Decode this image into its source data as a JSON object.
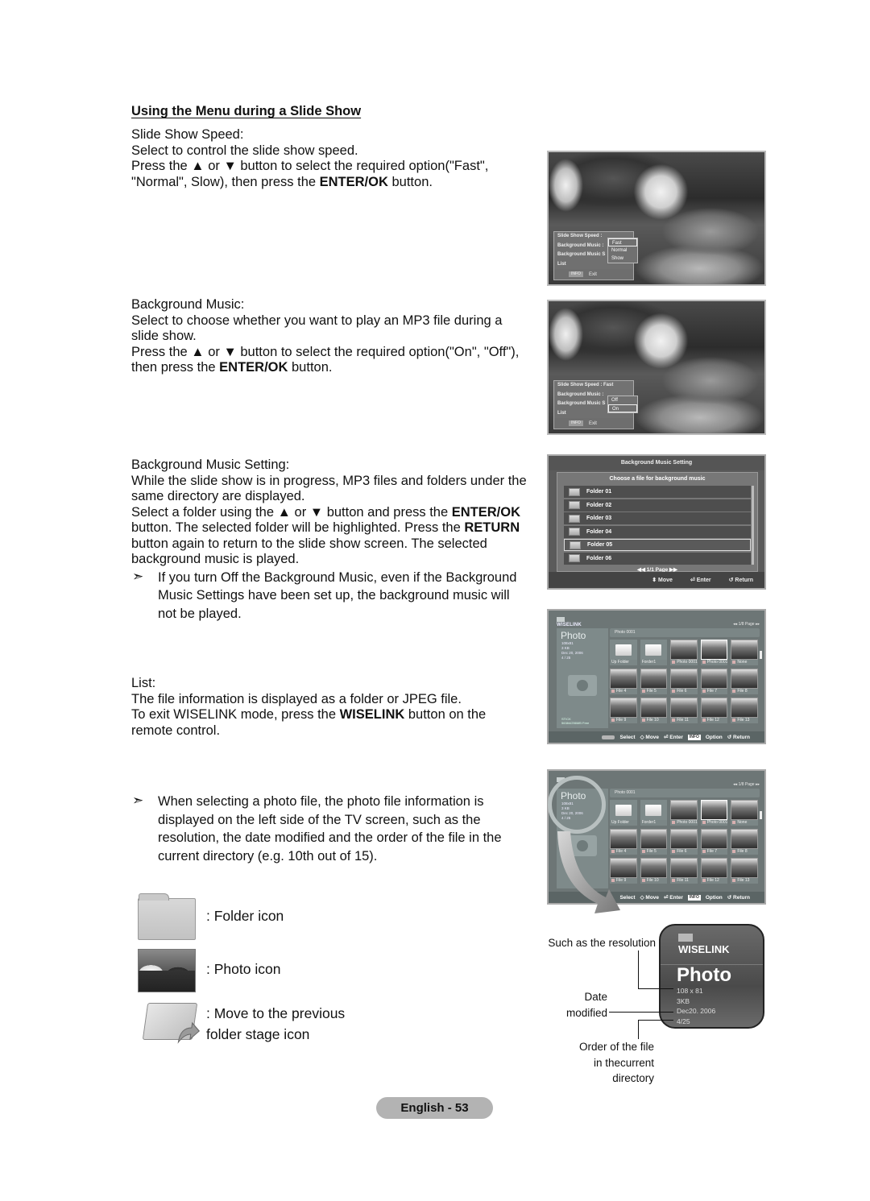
{
  "section_title": "Using the Menu during a Slide Show",
  "slide_show_speed": {
    "heading": "Slide Show Speed:",
    "lines": [
      "Select to control the slide show speed.",
      "Press the ▲ or ▼ button to select the required option(\"Fast\",",
      "\"Normal\", Slow), then press the ",
      "ENTER/OK",
      " button."
    ]
  },
  "background_music": {
    "heading": "Background Music:",
    "line1": "Select to choose whether you want to play an MP3 file during a\nslide show.",
    "line2a": "Press the ▲ or ▼ button to select the required option(\"On\", \"Off\"),\nthen press the ",
    "line2b": "ENTER/OK",
    "line2c": " button."
  },
  "bgm_setting_text": {
    "heading": "Background Music Setting:",
    "line1": "While the slide show is in progress, MP3 files and folders under the\nsame directory are displayed.",
    "line2a": "Select a folder using the ▲ or ▼ button and press the ",
    "line2b": "ENTER/OK",
    "line2c": "\nbutton. The selected folder will be highlighted. Press the ",
    "line2d": "RETURN",
    "line2e": "\nbutton again to return to the slide show screen. The selected\nbackground music is played.",
    "note_arrow": "➣",
    "note": "If you turn Off the Background Music, even if the Background\nMusic Settings have been set up, the background music will\nnot be played."
  },
  "list_text": {
    "heading": "List:",
    "line1": "The file information is displayed as a folder or JPEG file.",
    "line2a": "To exit WISELINK mode, press the ",
    "line2b": "WISELINK",
    "line2c": " button on the\nremote control."
  },
  "photo_note": {
    "arrow": "➣",
    "text": "When selecting a photo file, the photo file information is\ndisplayed on the left side of the TV screen, such as the\nresolution, the date modified and the order of the file in the\ncurrent directory (e.g. 10th out of 15)."
  },
  "legend": [
    {
      "icon": "folder-icon",
      "label": ": Folder icon"
    },
    {
      "icon": "photo-icon",
      "label": ": Photo icon"
    },
    {
      "icon": "up-folder-icon",
      "label": ": Move to the previous\n  folder stage icon"
    }
  ],
  "screen1": {
    "rows": [
      "Slide Show Speed :",
      "Background Music :",
      "Background Music S",
      "List"
    ],
    "options": [
      "Fast",
      "Normal",
      "Show"
    ],
    "selected_option": "Fast",
    "info_key": "INFO",
    "exit": "Exit"
  },
  "screen2": {
    "rows": [
      "Slide Show Speed : Fast",
      "Background Music :",
      "Background Music S",
      "List"
    ],
    "options": [
      "Off",
      "On"
    ],
    "selected_option": "On",
    "info_key": "INFO",
    "exit": "Exit"
  },
  "screen3": {
    "title": "Background Music Setting",
    "subtitle": "Choose a file for background music",
    "folders": [
      "Folder 01",
      "Folder 02",
      "Folder 03",
      "Folder 04",
      "Folder 05",
      "Folder 06"
    ],
    "selected_folder": "Folder 05",
    "page": "◀◀ 1/1 Page ▶▶",
    "footer": {
      "move": "⬍ Move",
      "enter": "⏎ Enter",
      "return": "↺ Return"
    }
  },
  "wiselink": {
    "logo": "WISELINK",
    "page": "◂◂ 1/8 Page ▸▸",
    "category": "Photo",
    "info": [
      "108x81",
      "3 KB",
      "Dec 20, 2006",
      "4 / 25"
    ],
    "stick": "STICK",
    "storage": "56384/256MB Free",
    "path": "Photo 0001",
    "grid": [
      {
        "label": "Up Folder",
        "type": "folder"
      },
      {
        "label": "Forder1",
        "type": "folder"
      },
      {
        "label": "Photo 0001",
        "type": "photo"
      },
      {
        "label": "Photo 0001",
        "type": "photo",
        "selected": true
      },
      {
        "label": "None",
        "type": "photo"
      },
      {
        "label": "File 4",
        "type": "photo"
      },
      {
        "label": "File 5",
        "type": "photo"
      },
      {
        "label": "File 6",
        "type": "photo"
      },
      {
        "label": "File 7",
        "type": "photo"
      },
      {
        "label": "File 8",
        "type": "photo"
      },
      {
        "label": "File 9",
        "type": "photo"
      },
      {
        "label": "File 10",
        "type": "photo"
      },
      {
        "label": "File 11",
        "type": "photo"
      },
      {
        "label": "File 12",
        "type": "photo"
      },
      {
        "label": "File 13",
        "type": "photo"
      }
    ],
    "footer": {
      "select": "Select",
      "move": "◇ Move",
      "enter": "⏎ Enter",
      "info_key": "INFO",
      "option": "Option",
      "return": "↺ Return"
    }
  },
  "info_card": {
    "logo": "WISELINK",
    "category": "Photo",
    "resolution": "108 x 81",
    "size": "3KB",
    "date": "Dec20. 2006",
    "order": "4/25"
  },
  "callouts": {
    "resolution": "Such as the resolution",
    "date": "Date\nmodified",
    "order": "Order of the file\nin thecurrent\ndirectory"
  },
  "page_footer": "English - 53"
}
